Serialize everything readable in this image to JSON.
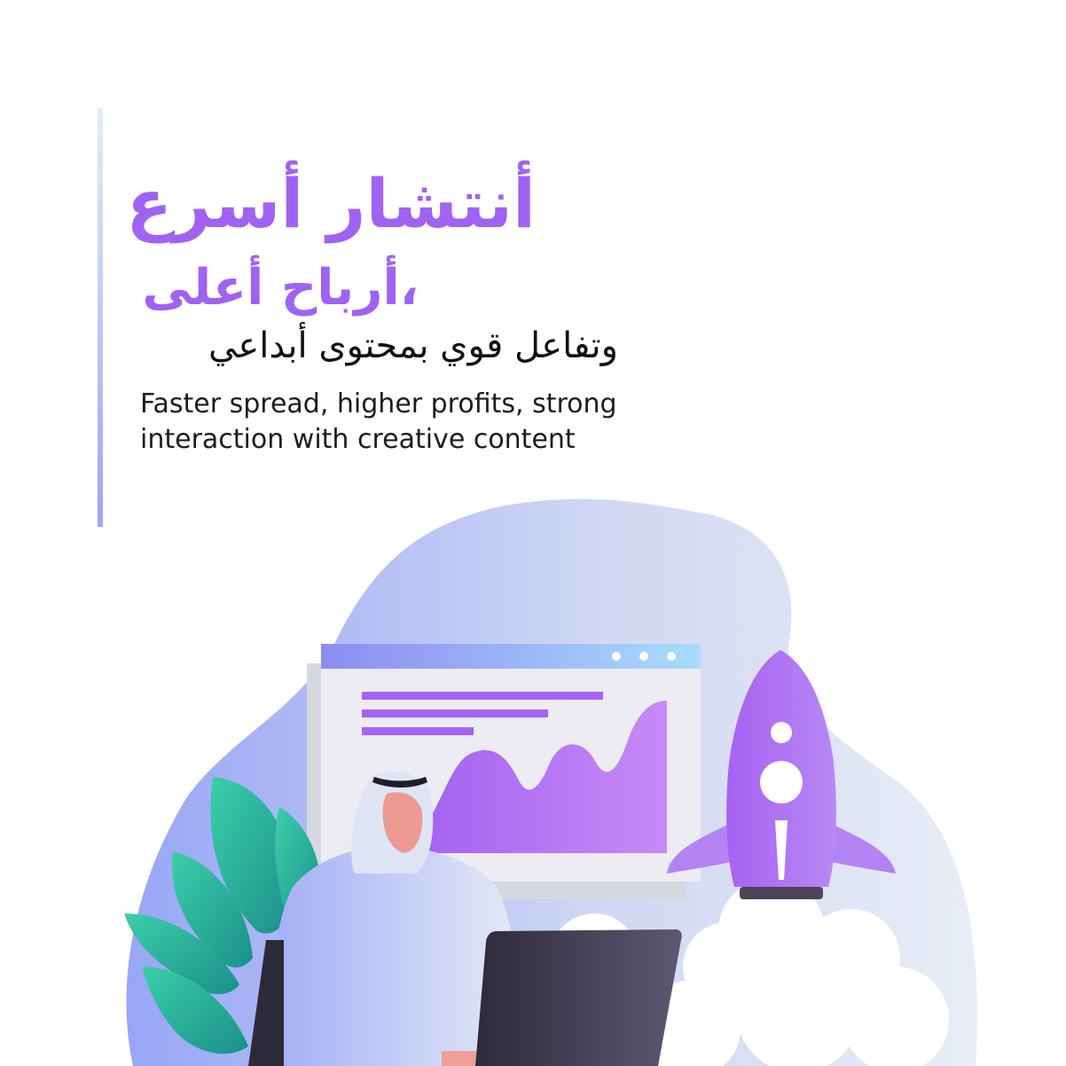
{
  "headline": {
    "line1": "أنتشار أسرع",
    "line2": "،أرباح أعلى",
    "line3": "وتفاعل قوي بمحتوى أبداعي"
  },
  "subtitle": {
    "line1": "Faster spread, higher profits, strong",
    "line2": "interaction with creative content"
  },
  "colors": {
    "accent": "#a062f3",
    "text": "#111111",
    "plant": "#2bb59a",
    "laptop": "#3a3448"
  },
  "icons": [
    "rocket-icon",
    "browser-window-icon",
    "plant-icon",
    "laptop-icon",
    "person-icon"
  ]
}
